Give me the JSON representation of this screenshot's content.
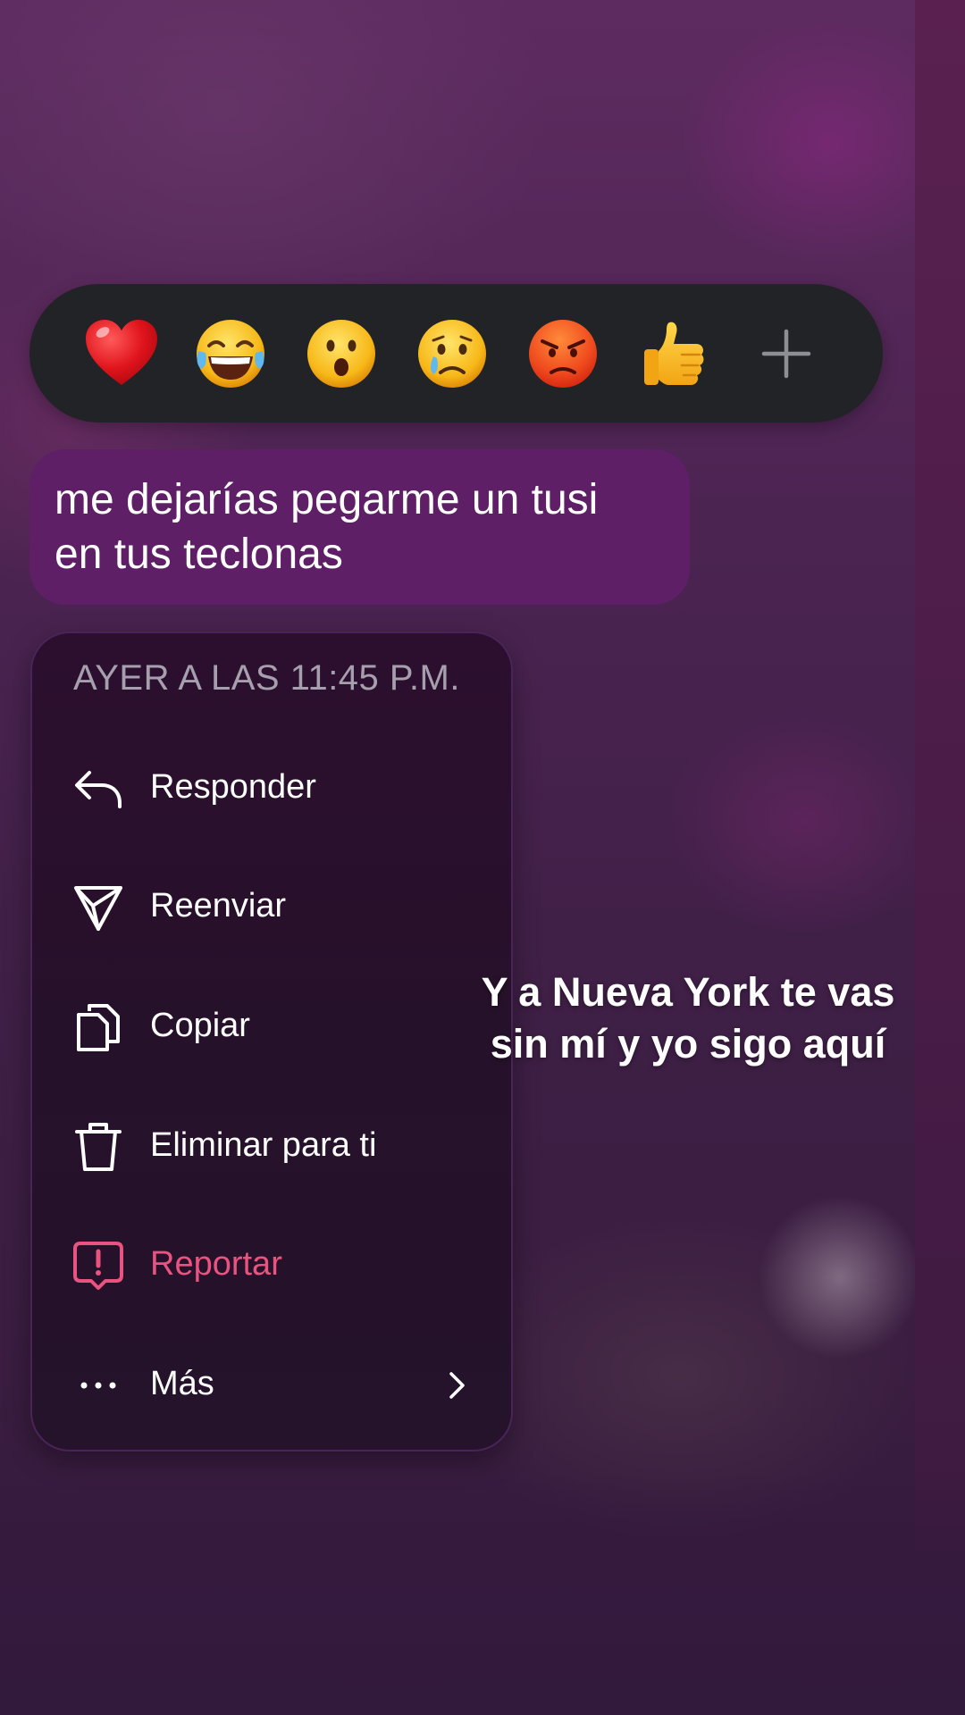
{
  "reactions": [
    {
      "name": "red-heart",
      "emoji": "❤️"
    },
    {
      "name": "tears-of-joy",
      "emoji": "😂"
    },
    {
      "name": "surprised",
      "emoji": "😮"
    },
    {
      "name": "crying",
      "emoji": "😢"
    },
    {
      "name": "angry",
      "emoji": "😡"
    },
    {
      "name": "thumbs-up",
      "emoji": "👍"
    },
    {
      "name": "add-reaction",
      "emoji": "+"
    }
  ],
  "message": {
    "line1": "me dejarías pegarme un tusi",
    "line2": "en tus teclonas"
  },
  "menu": {
    "timestamp": "AYER A LAS 11:45 P.M.",
    "items": [
      {
        "label": "Responder",
        "icon": "reply-icon"
      },
      {
        "label": "Reenviar",
        "icon": "send-icon"
      },
      {
        "label": "Copiar",
        "icon": "copy-icon"
      },
      {
        "label": "Eliminar para ti",
        "icon": "trash-icon"
      },
      {
        "label": "Reportar",
        "icon": "report-icon"
      },
      {
        "label": "Más",
        "icon": "more-dots-icon"
      }
    ]
  },
  "caption": {
    "line1": "Y a Nueva York te vas",
    "line2": "sin mí y yo sigo aquí"
  },
  "colors": {
    "reaction_bar": "#222326",
    "bubble": "#5e1f66",
    "menu_bg": "#2a1230",
    "danger": "#e8537f",
    "timestamp": "#a69fae"
  }
}
